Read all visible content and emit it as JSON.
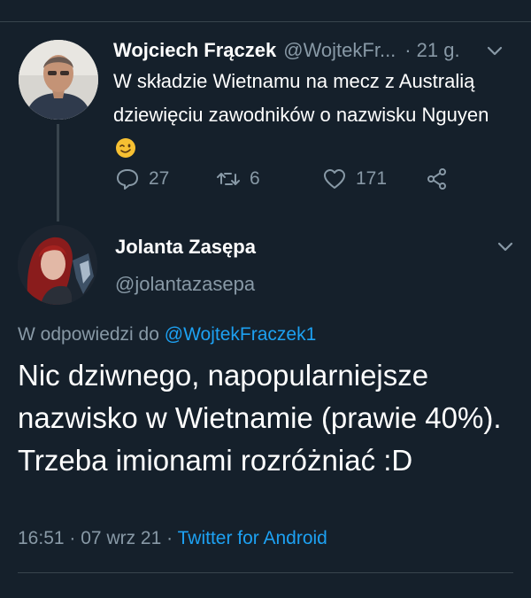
{
  "parent_tweet": {
    "author_name": "Wojciech Frączek",
    "author_handle": "@WojtekFr...",
    "time_sep": "·",
    "time": "21 g.",
    "text_before_emoji": "W składzie Wietnamu na mecz z Australią dziewięciu zawodników o nazwisku Nguyen",
    "emoji_icon": "winking-face-emoji",
    "stats": {
      "replies": "27",
      "retweets": "6",
      "likes": "171"
    },
    "icons": {
      "reply": "reply-icon",
      "retweet": "retweet-icon",
      "like": "heart-icon",
      "share": "share-icon",
      "menu": "chevron-down-icon"
    }
  },
  "reply_tweet": {
    "author_name": "Jolanta Zasępa",
    "author_handle": "@jolantazasepa",
    "reply_prefix": "W odpowiedzi do",
    "reply_mention": "@WojtekFraczek1",
    "text": "Nic dziwnego, napopularniejsze nazwisko w Wietnamie (prawie 40%). Trzeba imionami rozróżniać :D",
    "time": "16:51",
    "sep1": "·",
    "date": "07 wrz 21",
    "sep2": "·",
    "client": "Twitter for Android"
  },
  "colors": {
    "background": "#15202b",
    "secondary_text": "#8899a6",
    "accent": "#1da1f2",
    "divider": "#38444d"
  }
}
